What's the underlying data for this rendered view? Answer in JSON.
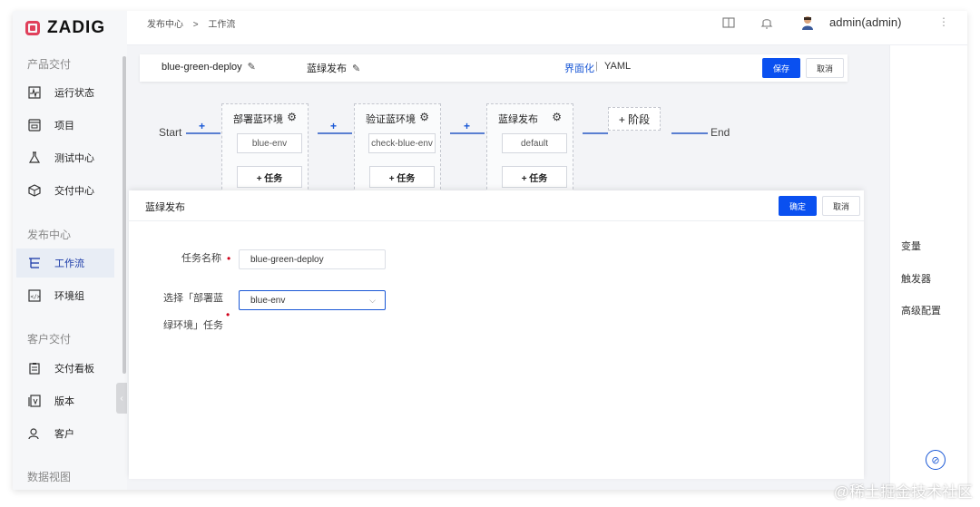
{
  "app": {
    "logo_text": "ZADIG"
  },
  "sidebar": {
    "sections": [
      {
        "label": "产品交付"
      },
      {
        "label": "发布中心"
      },
      {
        "label": "客户交付"
      },
      {
        "label": "数据视图"
      }
    ],
    "items": [
      {
        "label": "运行状态",
        "icon": "pulse-icon"
      },
      {
        "label": "项目",
        "icon": "project-icon"
      },
      {
        "label": "测试中心",
        "icon": "test-icon"
      },
      {
        "label": "交付中心",
        "icon": "delivery-icon"
      },
      {
        "label": "工作流",
        "icon": "workflow-icon",
        "active": true
      },
      {
        "label": "环境组",
        "icon": "environment-icon"
      },
      {
        "label": "交付看板",
        "icon": "board-icon"
      },
      {
        "label": "版本",
        "icon": "version-icon"
      },
      {
        "label": "客户",
        "icon": "customer-icon"
      }
    ]
  },
  "header": {
    "breadcrumb": [
      "发布中心",
      ">",
      "工作流"
    ],
    "user": "admin(admin)",
    "kebab": "⋮"
  },
  "toolbar": {
    "workflow_name": "blue-green-deploy",
    "stage_name": "蓝绿发布",
    "view_ui": "界面化",
    "separator": "|",
    "view_yaml": "YAML",
    "save_label": "保存",
    "cancel_label": "取消"
  },
  "pipeline": {
    "start": "Start",
    "end": "End",
    "add_stage": "+ 阶段",
    "stages": [
      {
        "title": "部署蓝环境",
        "job": "blue-env",
        "add_task": "+ 任务"
      },
      {
        "title": "验证蓝环境",
        "job": "check-blue-env",
        "add_task": "+ 任务"
      },
      {
        "title": "蓝绿发布",
        "job": "default",
        "add_task": "+ 任务"
      }
    ]
  },
  "drawer": {
    "title": "蓝绿发布",
    "confirm_label": "确定",
    "cancel_label": "取消",
    "task_name_label": "任务名称",
    "task_name_value": "blue-green-deploy",
    "select_label_line1": "选择「部署蓝",
    "select_label_line2": "绿环境」任务",
    "select_value": "blue-env"
  },
  "right_panel": {
    "items": [
      "变量",
      "触发器",
      "高级配置"
    ]
  },
  "watermark": "@稀土掘金技术社区",
  "colors": {
    "primary": "#0a50f0",
    "brand": "#e0405b",
    "link": "#1a58d6"
  }
}
